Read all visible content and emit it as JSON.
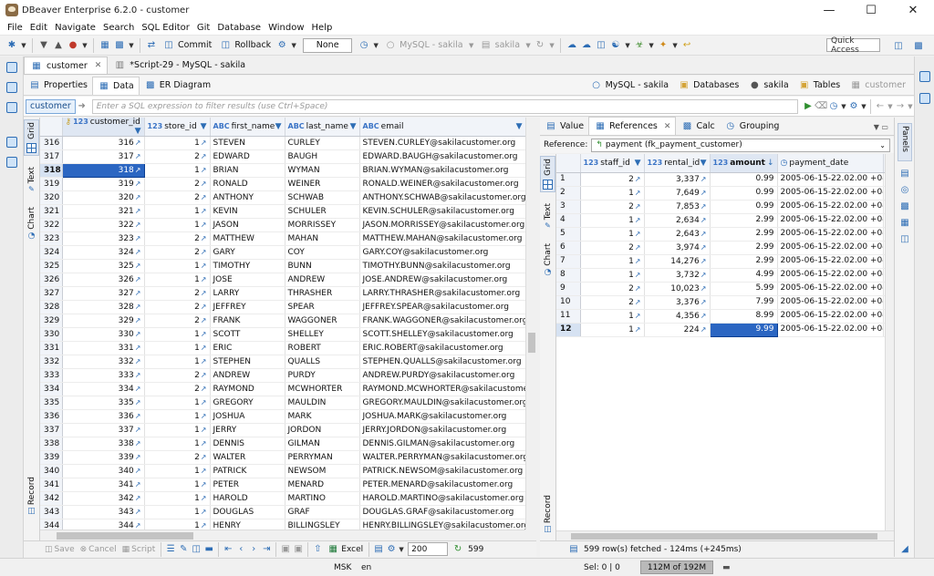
{
  "window": {
    "title": "DBeaver Enterprise 6.2.0 - customer"
  },
  "menu": [
    "File",
    "Edit",
    "Navigate",
    "Search",
    "SQL Editor",
    "Git",
    "Database",
    "Window",
    "Help"
  ],
  "toolbar": {
    "commit": "Commit",
    "rollback": "Rollback",
    "mode": "None",
    "connection": "MySQL - sakila",
    "schema": "sakila",
    "quick_access": "Quick Access"
  },
  "editor_tabs": [
    {
      "label": "customer",
      "active": true
    },
    {
      "label": "*Script-29 - MySQL - sakila",
      "active": false
    }
  ],
  "sub_tabs": [
    "Properties",
    "Data",
    "ER Diagram"
  ],
  "nav_path": [
    "MySQL - sakila",
    "Databases",
    "sakila",
    "Tables",
    "customer"
  ],
  "filter": {
    "table_chip": "customer",
    "placeholder": "Enter a SQL expression to filter results (use Ctrl+Space)"
  },
  "left_vtabs": [
    "Grid",
    "Text",
    "Chart",
    "Record"
  ],
  "left_grid": {
    "columns": [
      "customer_id",
      "store_id",
      "first_name",
      "last_name",
      "email"
    ],
    "type_tags": [
      "123",
      "123",
      "ABC",
      "ABC",
      "ABC"
    ],
    "rows": [
      [
        "316",
        "316",
        "1",
        "STEVEN",
        "CURLEY",
        "STEVEN.CURLEY@sakilacustomer.org"
      ],
      [
        "317",
        "317",
        "2",
        "EDWARD",
        "BAUGH",
        "EDWARD.BAUGH@sakilacustomer.org"
      ],
      [
        "318",
        "318",
        "1",
        "BRIAN",
        "WYMAN",
        "BRIAN.WYMAN@sakilacustomer.org"
      ],
      [
        "319",
        "319",
        "2",
        "RONALD",
        "WEINER",
        "RONALD.WEINER@sakilacustomer.org"
      ],
      [
        "320",
        "320",
        "2",
        "ANTHONY",
        "SCHWAB",
        "ANTHONY.SCHWAB@sakilacustomer.org"
      ],
      [
        "321",
        "321",
        "1",
        "KEVIN",
        "SCHULER",
        "KEVIN.SCHULER@sakilacustomer.org"
      ],
      [
        "322",
        "322",
        "1",
        "JASON",
        "MORRISSEY",
        "JASON.MORRISSEY@sakilacustomer.org"
      ],
      [
        "323",
        "323",
        "2",
        "MATTHEW",
        "MAHAN",
        "MATTHEW.MAHAN@sakilacustomer.org"
      ],
      [
        "324",
        "324",
        "2",
        "GARY",
        "COY",
        "GARY.COY@sakilacustomer.org"
      ],
      [
        "325",
        "325",
        "1",
        "TIMOTHY",
        "BUNN",
        "TIMOTHY.BUNN@sakilacustomer.org"
      ],
      [
        "326",
        "326",
        "1",
        "JOSE",
        "ANDREW",
        "JOSE.ANDREW@sakilacustomer.org"
      ],
      [
        "327",
        "327",
        "2",
        "LARRY",
        "THRASHER",
        "LARRY.THRASHER@sakilacustomer.org"
      ],
      [
        "328",
        "328",
        "2",
        "JEFFREY",
        "SPEAR",
        "JEFFREY.SPEAR@sakilacustomer.org"
      ],
      [
        "329",
        "329",
        "2",
        "FRANK",
        "WAGGONER",
        "FRANK.WAGGONER@sakilacustomer.org"
      ],
      [
        "330",
        "330",
        "1",
        "SCOTT",
        "SHELLEY",
        "SCOTT.SHELLEY@sakilacustomer.org"
      ],
      [
        "331",
        "331",
        "1",
        "ERIC",
        "ROBERT",
        "ERIC.ROBERT@sakilacustomer.org"
      ],
      [
        "332",
        "332",
        "1",
        "STEPHEN",
        "QUALLS",
        "STEPHEN.QUALLS@sakilacustomer.org"
      ],
      [
        "333",
        "333",
        "2",
        "ANDREW",
        "PURDY",
        "ANDREW.PURDY@sakilacustomer.org"
      ],
      [
        "334",
        "334",
        "2",
        "RAYMOND",
        "MCWHORTER",
        "RAYMOND.MCWHORTER@sakilacustomer."
      ],
      [
        "335",
        "335",
        "1",
        "GREGORY",
        "MAULDIN",
        "GREGORY.MAULDIN@sakilacustomer.org"
      ],
      [
        "336",
        "336",
        "1",
        "JOSHUA",
        "MARK",
        "JOSHUA.MARK@sakilacustomer.org"
      ],
      [
        "337",
        "337",
        "1",
        "JERRY",
        "JORDON",
        "JERRY.JORDON@sakilacustomer.org"
      ],
      [
        "338",
        "338",
        "1",
        "DENNIS",
        "GILMAN",
        "DENNIS.GILMAN@sakilacustomer.org"
      ],
      [
        "339",
        "339",
        "2",
        "WALTER",
        "PERRYMAN",
        "WALTER.PERRYMAN@sakilacustomer.org"
      ],
      [
        "340",
        "340",
        "1",
        "PATRICK",
        "NEWSOM",
        "PATRICK.NEWSOM@sakilacustomer.org"
      ],
      [
        "341",
        "341",
        "1",
        "PETER",
        "MENARD",
        "PETER.MENARD@sakilacustomer.org"
      ],
      [
        "342",
        "342",
        "1",
        "HAROLD",
        "MARTINO",
        "HAROLD.MARTINO@sakilacustomer.org"
      ],
      [
        "343",
        "343",
        "1",
        "DOUGLAS",
        "GRAF",
        "DOUGLAS.GRAF@sakilacustomer.org"
      ],
      [
        "344",
        "344",
        "1",
        "HENRY",
        "BILLINGSLEY",
        "HENRY.BILLINGSLEY@sakilacustomer.org"
      ],
      [
        "345",
        "345",
        "1",
        "CARL",
        "ARTIS",
        "CARL.ARTIS@sakilacustomer.org"
      ],
      [
        "346",
        "346",
        "2",
        "ARTHUR",
        "SIMPKINS",
        "ARTHUR.SIMPKINS@sakilacustomer.org"
      ]
    ],
    "selected_row": "318"
  },
  "left_bottom": {
    "save": "Save",
    "cancel": "Cancel",
    "script": "Script",
    "excel": "Excel",
    "page_size": "200",
    "row_count": "599"
  },
  "right_tabs": [
    "Value",
    "References",
    "Calc",
    "Grouping"
  ],
  "reference": {
    "label": "Reference:",
    "value": "payment (fk_payment_customer)"
  },
  "right_grid": {
    "columns": [
      "staff_id",
      "rental_id",
      "amount",
      "payment_date"
    ],
    "type_tags": [
      "123",
      "123",
      "123",
      ""
    ],
    "rows": [
      [
        "1",
        "2",
        "3,337",
        "0.99",
        "2005-06-15-22.02.00 +0400"
      ],
      [
        "2",
        "1",
        "7,649",
        "0.99",
        "2005-06-15-22.02.00 +0400"
      ],
      [
        "3",
        "2",
        "7,853",
        "0.99",
        "2005-06-15-22.02.00 +0400"
      ],
      [
        "4",
        "1",
        "2,634",
        "2.99",
        "2005-06-15-22.02.00 +0400"
      ],
      [
        "5",
        "1",
        "2,643",
        "2.99",
        "2005-06-15-22.02.00 +0400"
      ],
      [
        "6",
        "2",
        "3,974",
        "2.99",
        "2005-06-15-22.02.00 +0400"
      ],
      [
        "7",
        "1",
        "14,276",
        "2.99",
        "2005-06-15-22.02.00 +0400"
      ],
      [
        "8",
        "1",
        "3,732",
        "4.99",
        "2005-06-15-22.02.00 +0400"
      ],
      [
        "9",
        "2",
        "10,023",
        "5.99",
        "2005-06-15-22.02.00 +0400"
      ],
      [
        "10",
        "2",
        "3,376",
        "7.99",
        "2005-06-15-22.02.00 +0400"
      ],
      [
        "11",
        "1",
        "4,356",
        "8.99",
        "2005-06-15-22.02.00 +0400"
      ],
      [
        "12",
        "1",
        "224",
        "9.99",
        "2005-06-15-22.02.00 +0400"
      ]
    ],
    "selected_row": "12"
  },
  "right_bottom": {
    "fetched": "599 row(s) fetched - 124ms (+245ms)"
  },
  "side_panels_label": "Panels",
  "status": {
    "lang": "MSK",
    "locale": "en",
    "sel": "Sel: 0 | 0",
    "heap": "112M of 192M"
  }
}
